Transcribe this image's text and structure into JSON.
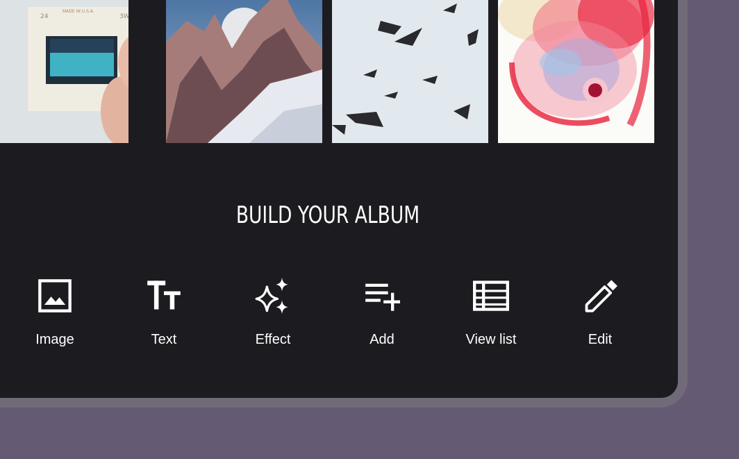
{
  "section": {
    "title": "BUILD YOUR ALBUM"
  },
  "tools": [
    {
      "label": "Image",
      "icon": "image-icon"
    },
    {
      "label": "Text",
      "icon": "text-icon"
    },
    {
      "label": "Effect",
      "icon": "sparkle-icon"
    },
    {
      "label": "Add",
      "icon": "playlist-add-icon"
    },
    {
      "label": "View list",
      "icon": "view-list-icon"
    },
    {
      "label": "Edit",
      "icon": "pencil-icon"
    }
  ],
  "photos": {
    "slide_print": "MADE IN U.S.A.",
    "slide_number": "24",
    "slide_code": "3W"
  },
  "colors": {
    "background": "#655a73",
    "frame": "#716a78",
    "screen": "#1c1b20",
    "text": "#ffffff"
  }
}
